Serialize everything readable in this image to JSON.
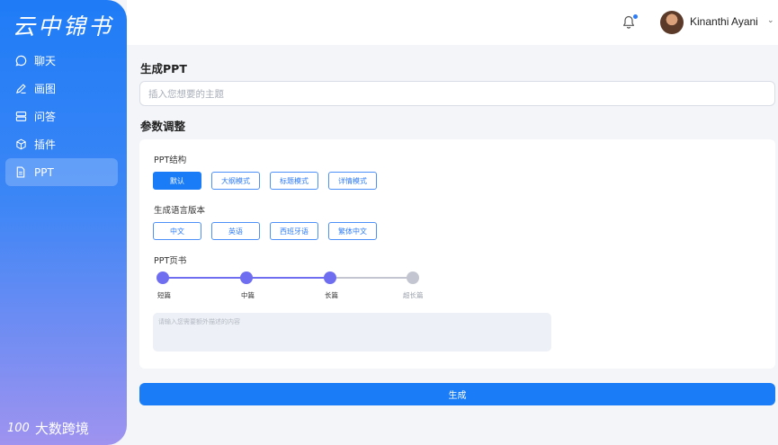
{
  "sidebar": {
    "logo": "云中锦书",
    "items": [
      {
        "label": "聊天",
        "icon": "chat-bubble-icon"
      },
      {
        "label": "画图",
        "icon": "pencil-icon"
      },
      {
        "label": "问答",
        "icon": "server-stack-icon"
      },
      {
        "label": "插件",
        "icon": "cube-icon"
      },
      {
        "label": "PPT",
        "icon": "document-icon"
      }
    ],
    "active_index": 4,
    "brand": {
      "mark": "100",
      "name": "大数跨境"
    }
  },
  "header": {
    "notification_icon": "bell-icon",
    "user_name": "Kinanthi Ayani"
  },
  "main": {
    "title": "生成PPT",
    "topic_placeholder": "插入您想要的主题",
    "params_title": "参数调整",
    "structure": {
      "label": "PPT结构",
      "options": [
        "默认",
        "大纲模式",
        "标题模式",
        "详情模式"
      ],
      "selected": 0
    },
    "language": {
      "label": "生成语言版本",
      "options": [
        "中文",
        "英语",
        "西班牙语",
        "繁体中文"
      ]
    },
    "pages": {
      "label": "PPT页书",
      "stops": [
        "短篇",
        "中篇",
        "长篇",
        "超长篇"
      ],
      "selected_index": 2
    },
    "extra_placeholder": "请输入您需要额外描述的内容",
    "generate_label": "生成"
  },
  "colors": {
    "accent": "#1a7cf7",
    "slider_active": "#6f6ef0",
    "slider_inactive": "#c3c6d0"
  }
}
